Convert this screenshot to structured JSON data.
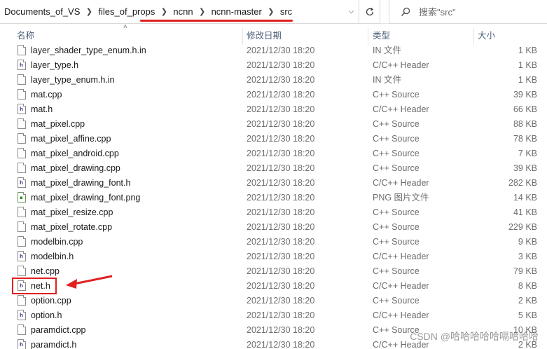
{
  "breadcrumb": [
    {
      "label": "Documents_of_VS"
    },
    {
      "label": "files_of_props"
    },
    {
      "label": "ncnn"
    },
    {
      "label": "ncnn-master"
    },
    {
      "label": "src"
    }
  ],
  "search": {
    "placeholder": "搜索\"src\""
  },
  "columns": {
    "name": "名称",
    "date": "修改日期",
    "type": "类型",
    "size": "大小"
  },
  "files": [
    {
      "name": "layer_shader_type_enum.h.in",
      "date": "2021/12/30 18:20",
      "type": "IN 文件",
      "size": "1 KB",
      "icon": "file-icon"
    },
    {
      "name": "layer_type.h",
      "date": "2021/12/30 18:20",
      "type": "C/C++ Header",
      "size": "1 KB",
      "icon": "header-file-icon"
    },
    {
      "name": "layer_type_enum.h.in",
      "date": "2021/12/30 18:20",
      "type": "IN 文件",
      "size": "1 KB",
      "icon": "file-icon"
    },
    {
      "name": "mat.cpp",
      "date": "2021/12/30 18:20",
      "type": "C++ Source",
      "size": "39 KB",
      "icon": "cpp-file-icon"
    },
    {
      "name": "mat.h",
      "date": "2021/12/30 18:20",
      "type": "C/C++ Header",
      "size": "66 KB",
      "icon": "header-file-icon"
    },
    {
      "name": "mat_pixel.cpp",
      "date": "2021/12/30 18:20",
      "type": "C++ Source",
      "size": "88 KB",
      "icon": "cpp-file-icon"
    },
    {
      "name": "mat_pixel_affine.cpp",
      "date": "2021/12/30 18:20",
      "type": "C++ Source",
      "size": "78 KB",
      "icon": "cpp-file-icon"
    },
    {
      "name": "mat_pixel_android.cpp",
      "date": "2021/12/30 18:20",
      "type": "C++ Source",
      "size": "7 KB",
      "icon": "cpp-file-icon"
    },
    {
      "name": "mat_pixel_drawing.cpp",
      "date": "2021/12/30 18:20",
      "type": "C++ Source",
      "size": "39 KB",
      "icon": "cpp-file-icon"
    },
    {
      "name": "mat_pixel_drawing_font.h",
      "date": "2021/12/30 18:20",
      "type": "C/C++ Header",
      "size": "282 KB",
      "icon": "header-file-icon"
    },
    {
      "name": "mat_pixel_drawing_font.png",
      "date": "2021/12/30 18:20",
      "type": "PNG 图片文件",
      "size": "14 KB",
      "icon": "png-file-icon"
    },
    {
      "name": "mat_pixel_resize.cpp",
      "date": "2021/12/30 18:20",
      "type": "C++ Source",
      "size": "41 KB",
      "icon": "cpp-file-icon"
    },
    {
      "name": "mat_pixel_rotate.cpp",
      "date": "2021/12/30 18:20",
      "type": "C++ Source",
      "size": "229 KB",
      "icon": "cpp-file-icon"
    },
    {
      "name": "modelbin.cpp",
      "date": "2021/12/30 18:20",
      "type": "C++ Source",
      "size": "9 KB",
      "icon": "cpp-file-icon"
    },
    {
      "name": "modelbin.h",
      "date": "2021/12/30 18:20",
      "type": "C/C++ Header",
      "size": "3 KB",
      "icon": "header-file-icon"
    },
    {
      "name": "net.cpp",
      "date": "2021/12/30 18:20",
      "type": "C++ Source",
      "size": "79 KB",
      "icon": "cpp-file-icon"
    },
    {
      "name": "net.h",
      "date": "2021/12/30 18:20",
      "type": "C/C++ Header",
      "size": "8 KB",
      "icon": "header-file-icon"
    },
    {
      "name": "option.cpp",
      "date": "2021/12/30 18:20",
      "type": "C++ Source",
      "size": "2 KB",
      "icon": "cpp-file-icon"
    },
    {
      "name": "option.h",
      "date": "2021/12/30 18:20",
      "type": "C/C++ Header",
      "size": "5 KB",
      "icon": "header-file-icon"
    },
    {
      "name": "paramdict.cpp",
      "date": "2021/12/30 18:20",
      "type": "C++ Source",
      "size": "10 KB",
      "icon": "cpp-file-icon"
    },
    {
      "name": "paramdict.h",
      "date": "2021/12/30 18:20",
      "type": "C/C++ Header",
      "size": "2 KB",
      "icon": "header-file-icon"
    }
  ],
  "watermark": "CSDN @哈哈哈哈哈嗝哈哈哈",
  "colors": {
    "annotation_red": "#e02020",
    "header_text": "#4c607a"
  }
}
